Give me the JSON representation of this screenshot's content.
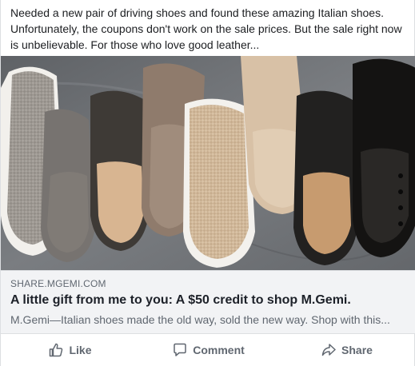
{
  "post": {
    "text": "Needed a new pair of driving shoes and found these amazing Italian shoes. Unfortunately, the coupons don't work on the sale prices. But the sale right now is unbelievable. For those who love good leather..."
  },
  "link_preview": {
    "domain": "SHARE.MGEMI.COM",
    "title": "A little gift from me to you: A $50 credit to shop M.Gemi.",
    "description": "M.Gemi—Italian shoes made the old way, sold the new way. Shop with this..."
  },
  "actions": {
    "like_label": "Like",
    "comment_label": "Comment",
    "share_label": "Share"
  },
  "colors": {
    "background_slate": "#6f7276",
    "action_text": "#606770",
    "preview_bg": "#f2f3f5"
  }
}
